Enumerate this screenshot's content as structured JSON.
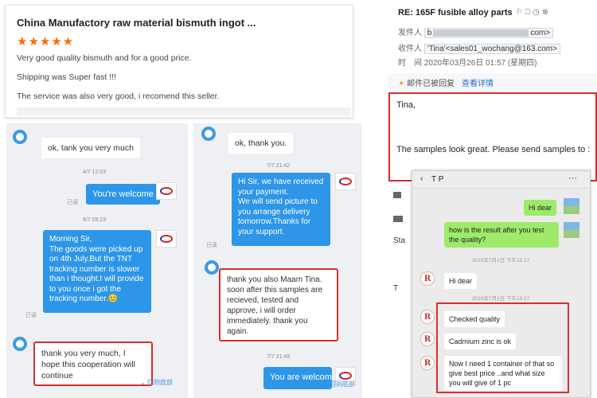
{
  "review": {
    "title": "China Manufactory raw material bismuth ingot ...",
    "stars": "★★★★★",
    "lines": [
      "Very good quality bismuth and for a good price.",
      "Shipping was Super fast !!!",
      "The service was also very good, i recomend this seller."
    ]
  },
  "chat1": {
    "msg1": "ok, tank you very much",
    "ts1": "4/7 12:03",
    "msg2": "You're welcome",
    "read": "已读",
    "ts2": "6/7 09:23",
    "msg3": "Morning Sir,\nThe goods were picked up on 4th July.But the TNT tracking number is slower than i thought.I will provide to you once i got the tracking number.😊",
    "msg4": "thank you very much, I hope this cooperation will continue",
    "back": "回到底部"
  },
  "chat2": {
    "msg1": "ok, thank you.",
    "ts1": "7/7 21:42",
    "msg2": "Hi Sir, we have received your payment.\nWe will send picture to you arrange delivery tomorrow.Thanks for your support.",
    "read": "已读",
    "msg3": "thank you also Maam Tina. soon after this samples are recieved, tested and approve, i will order immediately. thank you again.",
    "ts2": "7/7 21:49",
    "msg4": "You are welcom",
    "back": "回到底部"
  },
  "email": {
    "subject": "RE: 165F fusible alloy parts",
    "from_label": "发件人",
    "from_value": "b",
    "from_tail": "com>",
    "to_label": "收件人",
    "to_value": "'Tina'<sales01_wochang@163.com>",
    "time_label": "时　间",
    "time_value": "2020年03月26日 01:57 (星期四)",
    "replied": "邮件已被回复",
    "view_detail": "查看详情",
    "greeting": "Tina,",
    "body": "The samples  look great. Please send samples to :",
    "side_text": [
      "Sta",
      "T"
    ]
  },
  "wechat": {
    "title": "T P",
    "m1": "Hi dear",
    "m2": "how is the result after you test the quality?",
    "ts1": "2019年7月1日 下午15:17",
    "m3": "Hi dear",
    "ts2": "2019年7月1日 下午15:17",
    "m4": "Checked quality",
    "m5": "Cadmium zinc is ok",
    "m6": "Now I need 1 container of that so give best price ..and what size you will give of 1 pc"
  },
  "colors": {
    "star": "#ff6a00",
    "blue_bubble": "#2e96e8",
    "green_bubble": "#9eea6a",
    "highlight_box": "#d62e2e"
  }
}
